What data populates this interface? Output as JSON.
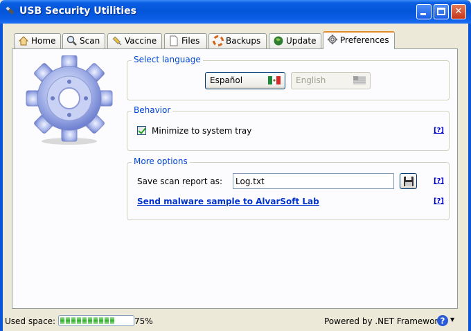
{
  "window": {
    "title": "USB Security Utilities"
  },
  "tabs": [
    {
      "label": "Home",
      "icon": "home-icon"
    },
    {
      "label": "Scan",
      "icon": "magnifier-icon"
    },
    {
      "label": "Vaccine",
      "icon": "syringe-icon"
    },
    {
      "label": "Files",
      "icon": "document-icon"
    },
    {
      "label": "Backups",
      "icon": "lifebuoy-icon"
    },
    {
      "label": "Update",
      "icon": "globe-icon"
    },
    {
      "label": "Preferences",
      "icon": "gear-icon",
      "active": true
    }
  ],
  "language": {
    "title": "Select language",
    "spanish": "Español",
    "english": "English"
  },
  "behavior": {
    "title": "Behavior",
    "minimize_label": "Minimize to system tray",
    "minimize_checked": true,
    "help": "[?]"
  },
  "more_options": {
    "title": "More options",
    "save_label": "Save scan report as:",
    "save_value": "Log.txt",
    "help1": "[?]",
    "link": "Send malware sample to AlvarSoft Lab",
    "help2": "[?]"
  },
  "status": {
    "used_label": "Used space:",
    "used_percent": "75%",
    "used_fraction": 0.75,
    "powered_by": "Powered by .NET Framework"
  },
  "colors": {
    "title_bar": "#0454d8",
    "group_title": "#0046d5",
    "active_tab_accent": "#e68b2c"
  }
}
